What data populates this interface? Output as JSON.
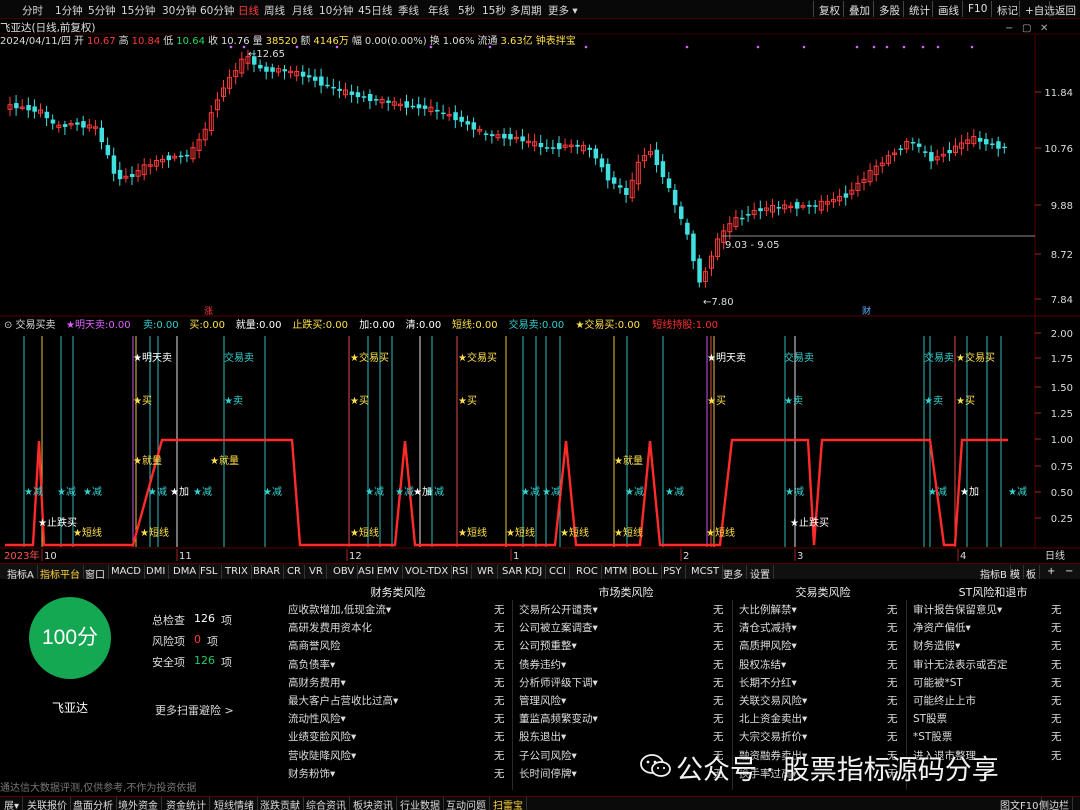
{
  "toolbar": {
    "timeframes": [
      "分时",
      "1分钟",
      "5分钟",
      "15分钟",
      "30分钟",
      "60分钟",
      "日线",
      "周线",
      "月线",
      "10分钟",
      "45日线",
      "季线",
      "年线",
      "5秒",
      "15秒",
      "多周期",
      "更多 ▾"
    ],
    "active_timeframe": "日线",
    "right_buttons": [
      "复权",
      "叠加",
      "多股",
      "统计",
      "画线",
      "F10",
      "标记",
      "+自选",
      "返回"
    ]
  },
  "title": "飞亚达(日线,前复权)",
  "info": {
    "date": "2024/04/11/四",
    "open_label": "开",
    "open": "10.67",
    "high_label": "高",
    "high": "10.84",
    "low_label": "低",
    "low": "10.64",
    "close_label": "收",
    "close": "10.76",
    "volume_label": "量",
    "volume": "38520",
    "amount_label": "额",
    "amount": "4146万",
    "change_label": "幅",
    "change": "0.00(0.00%)",
    "turnover_label": "换",
    "turnover": "1.06%",
    "float_label": "流通",
    "float": "3.63亿",
    "tag": "钟表拌宝"
  },
  "price_axis": [
    "11.84",
    "10.76",
    "9.88",
    "8.72",
    "7.84"
  ],
  "price_annotations": {
    "high": "←12.65",
    "low": "←7.80",
    "range": "9.03 - 9.05",
    "bottom_tag_left": "涨",
    "bottom_tag_right": "财"
  },
  "indicator": {
    "name": "交易买卖",
    "legend": [
      {
        "label": "★明天卖:",
        "value": "0.00",
        "color": "#e060ff"
      },
      {
        "label": "卖:",
        "value": "0.00",
        "color": "#35d0d0"
      },
      {
        "label": "买:",
        "value": "0.00",
        "color": "#ffe04a"
      },
      {
        "label": "就量:",
        "value": "0.00",
        "color": "#ffffff"
      },
      {
        "label": "止跌买:",
        "value": "0.00",
        "color": "#ffe04a"
      },
      {
        "label": "加:",
        "value": "0.00",
        "color": "#ffffff"
      },
      {
        "label": "清:",
        "value": "0.00",
        "color": "#ffffff"
      },
      {
        "label": "短线:",
        "value": "0.00",
        "color": "#ffe04a"
      },
      {
        "label": "交易卖:",
        "value": "0.00",
        "color": "#35d0d0"
      },
      {
        "label": "★交易买:",
        "value": "0.00",
        "color": "#ffe04a"
      },
      {
        "label": "短线持股:",
        "value": "1.00",
        "color": "#ff3030"
      }
    ],
    "axis": [
      "2.00",
      "1.75",
      "1.50",
      "1.25",
      "1.00",
      "0.75",
      "0.50",
      "0.25"
    ],
    "signals": {
      "trade_buy": "交易买",
      "trade_sell": "交易卖",
      "tomorrow_sell": "★明天卖",
      "sell": "卖",
      "buy": "买",
      "volume": "★就量",
      "reduce": "减",
      "add": "★加",
      "stop_buy": "★止跌买",
      "short": "★短线"
    }
  },
  "date_axis": {
    "year": "2023年",
    "marks": [
      "10",
      "11",
      "12",
      "1",
      "2",
      "3",
      "4"
    ],
    "period": "日线"
  },
  "indicator_tabs": [
    "指标A",
    "指标平台",
    "窗口",
    "MACD",
    "DMI",
    "DMA",
    "FSL",
    "TRIX",
    "BRAR",
    "CR",
    "VR",
    "OBV",
    "ASI",
    "EMV",
    "VOL-TDX",
    "RSI",
    "WR",
    "SAR",
    "KDJ",
    "CCI",
    "ROC",
    "MTM",
    "BOLL",
    "PSY",
    "MCST",
    "更多",
    "设置"
  ],
  "indicator_tabs_right": [
    "指标B",
    "模",
    "板"
  ],
  "risk": {
    "score": "100分",
    "stock": "飞亚达",
    "summary": [
      {
        "label": "总检查",
        "value": "126",
        "unit": "项",
        "color": "#ffffff"
      },
      {
        "label": "风险项",
        "value": "0",
        "unit": "项",
        "color": "#ff3b3b"
      },
      {
        "label": "安全项",
        "value": "126",
        "unit": "项",
        "color": "#22cc66"
      }
    ],
    "more": "更多扫雷避险 >",
    "columns": [
      {
        "title": "财务类风险",
        "items": [
          "应收款增加,低现金流▾",
          "高研发费用资本化",
          "高商誉风险",
          "高负债率▾",
          "高财务费用▾",
          "最大客户占营收比过高▾",
          "流动性风险▾",
          "业绩变脸风险▾",
          "营收陡降风险▾",
          "财务粉饰▾"
        ]
      },
      {
        "title": "市场类风险",
        "items": [
          "交易所公开谴责▾",
          "公司被立案调查▾",
          "公司预重整▾",
          "债券违约▾",
          "分析师评级下调▾",
          "管理风险▾",
          "董监高频繁变动▾",
          "股东退出▾",
          "子公司风险▾",
          "长时间停牌▾"
        ]
      },
      {
        "title": "交易类风险",
        "items": [
          "大比例解禁▾",
          "清仓式减持▾",
          "高质押风险▾",
          "股权冻结▾",
          "长期不分红▾",
          "关联交易风险▾",
          "北上资金卖出▾",
          "大宗交易折价▾",
          "融资融券卖出▾",
          "换手率过高▾"
        ]
      },
      {
        "title": "ST风险和退市",
        "items": [
          "审计报告保留意见▾",
          "净资产偏低▾",
          "财务造假▾",
          "审计无法表示或否定",
          "可能被*ST",
          "可能终止上市",
          "ST股票",
          "*ST股票",
          "进入退市整理",
          ""
        ]
      }
    ],
    "none_label": "无",
    "disclaimer": "通达信大数据评测,仅供参考,不作为投资依据"
  },
  "watermark": "公众号 · 股票指标源码分享",
  "bottom_tabs": [
    "展▾",
    "关联报价",
    "盘面分析",
    "境外资金",
    "资金统计",
    "短线情绪",
    "涨跌贡献",
    "综合资讯",
    "板块资讯",
    "行业数据",
    "互动问题",
    "扫雷宝"
  ],
  "bottom_right": [
    "图文F10",
    "侧边栏"
  ],
  "colors": {
    "up": "#ff3b3b",
    "down": "#40e0e0",
    "hold_line": "#ff2a2a",
    "grid": "#3a0000",
    "tomorrow_sell": "#e060ff",
    "trade_buy": "#ffe04a",
    "trade_sell": "#35d0d0"
  }
}
